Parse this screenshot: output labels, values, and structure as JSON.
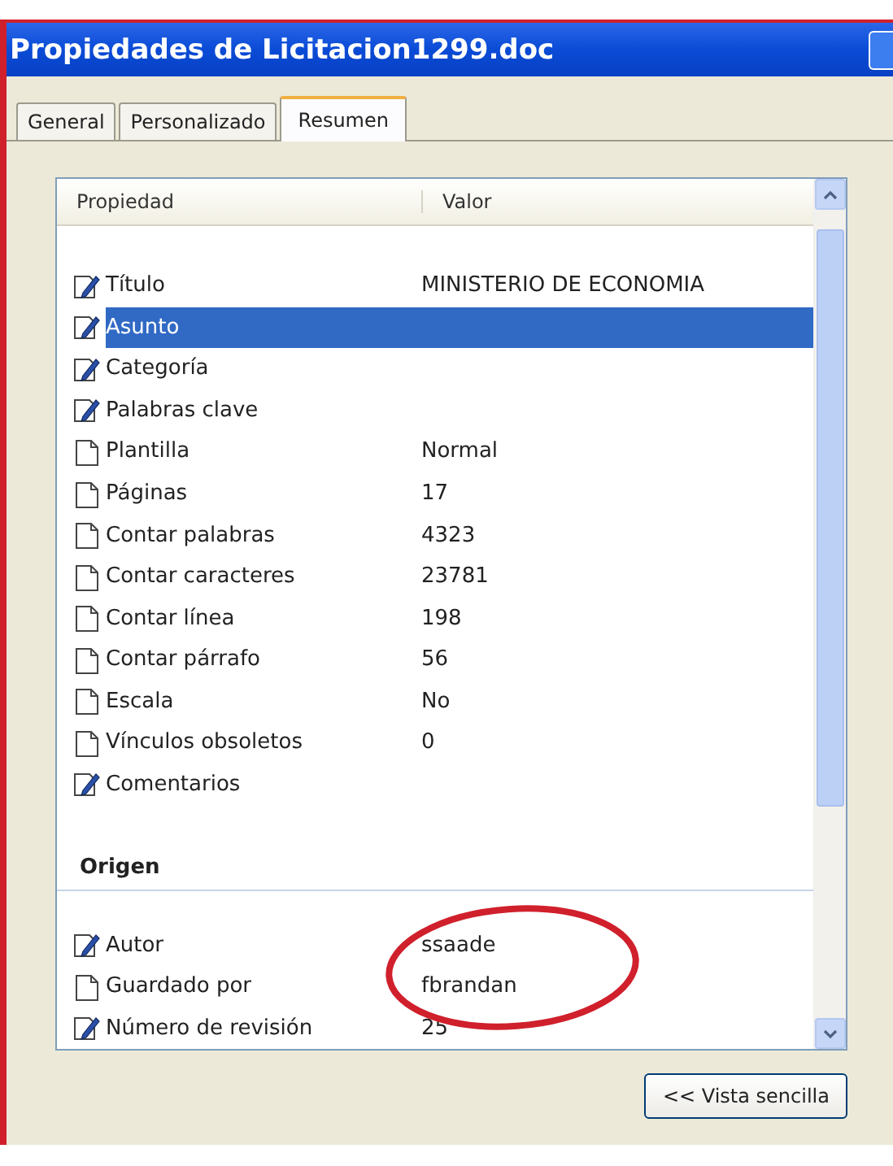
{
  "window": {
    "title": "Propiedades de Licitacion1299.doc"
  },
  "tabs": [
    {
      "label": "General",
      "selected": false
    },
    {
      "label": "Personalizado",
      "selected": false
    },
    {
      "label": "Resumen",
      "selected": true
    }
  ],
  "table": {
    "columns": [
      "Propiedad",
      "Valor"
    ],
    "sections": [
      {
        "rows": [
          {
            "kind": "editable",
            "name": "Título",
            "value": "MINISTERIO DE ECONOMIA",
            "selected": false
          },
          {
            "kind": "editable",
            "name": "Asunto",
            "selected": true
          },
          {
            "kind": "editable",
            "name": "Categoría",
            "selected": false
          },
          {
            "kind": "editable",
            "name": "Palabras clave",
            "selected": false
          },
          {
            "kind": "readonly",
            "name": "Plantilla",
            "value": "Normal",
            "selected": false
          },
          {
            "kind": "readonly",
            "name": "Páginas",
            "value": "17",
            "selected": false
          },
          {
            "kind": "readonly",
            "name": "Contar palabras",
            "value": "4323",
            "selected": false
          },
          {
            "kind": "readonly",
            "name": "Contar caracteres",
            "value": "23781",
            "selected": false
          },
          {
            "kind": "readonly",
            "name": "Contar línea",
            "value": "198",
            "selected": false
          },
          {
            "kind": "readonly",
            "name": "Contar párrafo",
            "value": "56",
            "selected": false
          },
          {
            "kind": "readonly",
            "name": "Escala",
            "value": "No",
            "selected": false
          },
          {
            "kind": "readonly",
            "name": "Vínculos obsoletos",
            "value": "0",
            "selected": false
          },
          {
            "kind": "editable",
            "name": "Comentarios",
            "selected": false
          }
        ]
      },
      {
        "title": "Origen",
        "rows": [
          {
            "kind": "editable",
            "name": "Autor",
            "value": "ssaade",
            "selected": false
          },
          {
            "kind": "readonly",
            "name": "Guardado por",
            "value": "fbrandan",
            "selected": false
          },
          {
            "kind": "editable",
            "name": "Número de revisión",
            "value": "25",
            "selected": false
          }
        ]
      }
    ]
  },
  "annotation": {
    "kind": "ellipse",
    "color": "#d0202c"
  },
  "buttons": [
    "<< Vista sencilla"
  ]
}
